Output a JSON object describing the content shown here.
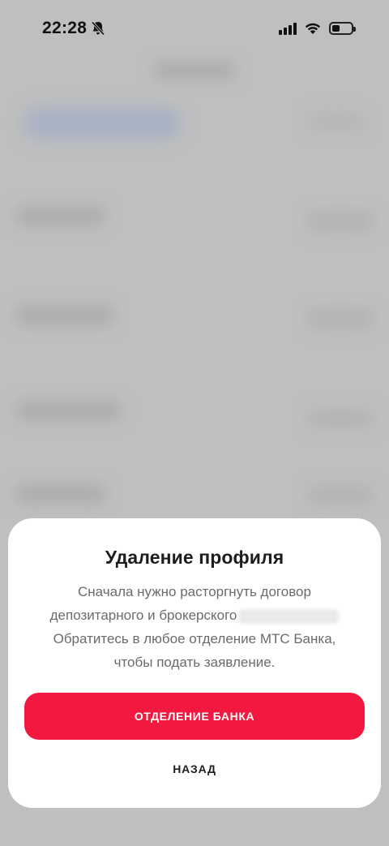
{
  "status_bar": {
    "time": "22:28",
    "icons": [
      "bell-slash-icon",
      "signal-icon",
      "wifi-icon",
      "battery-icon"
    ]
  },
  "dialog": {
    "title": "Удаление профиля",
    "body_line1": "Сначала нужно расторгнуть договор",
    "body_line2": "депозитарного и брокерского",
    "body_line3": "Обратитесь в любое отделение МТС Банка,",
    "body_line4": "чтобы подать заявление.",
    "primary_button_label": "ОТДЕЛЕНИЕ БАНКА",
    "secondary_button_label": "НАЗАД"
  },
  "colors": {
    "accent": "#f2183f",
    "overlay": "#bfbfbf",
    "sheet": "#ffffff"
  }
}
